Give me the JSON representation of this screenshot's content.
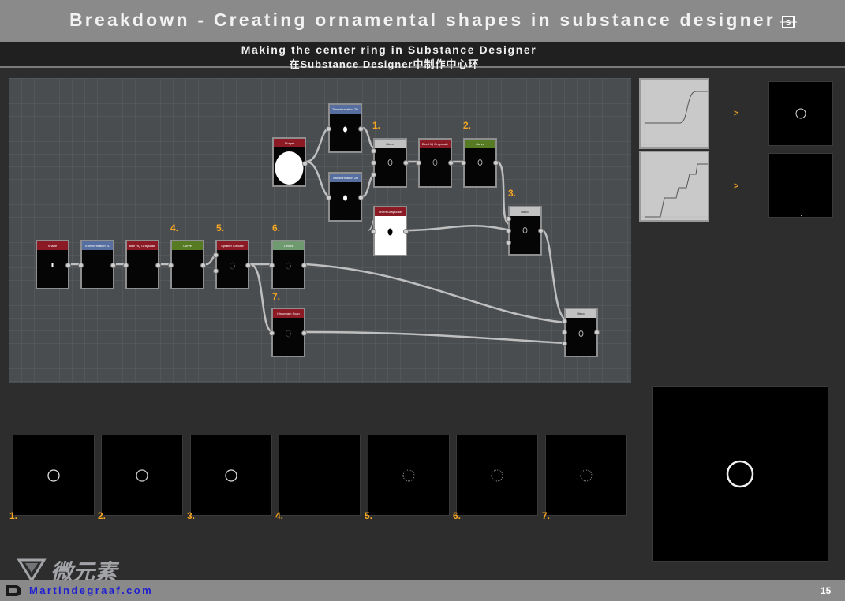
{
  "header": {
    "title": "Breakdown - Creating ornamental shapes in substance designer",
    "subtitle_en": "Making the center ring in Substance Designer",
    "subtitle_cn": "在Substance Designer中制作中心环"
  },
  "graph": {
    "nodes": [
      {
        "label": "Shape"
      },
      {
        "label": "Transformation 2D"
      },
      {
        "label": "Transformation 2D"
      },
      {
        "label": "Blend"
      },
      {
        "label": "Blur HQ Grayscale"
      },
      {
        "label": "Curve"
      },
      {
        "label": "Invert Grayscale"
      },
      {
        "label": "Blend"
      },
      {
        "label": "Shape"
      },
      {
        "label": "Transformation 2D"
      },
      {
        "label": "Blur HQ Grayscale"
      },
      {
        "label": "Curve"
      },
      {
        "label": "Splatter Circular"
      },
      {
        "label": "Levels"
      },
      {
        "label": "Histogram Scan"
      },
      {
        "label": "Blend"
      }
    ],
    "step_labels": [
      "1.",
      "2.",
      "3.",
      "4.",
      "5.",
      "6.",
      "7."
    ]
  },
  "curves": {
    "arrow": ">"
  },
  "previews": {
    "labels": [
      "1.",
      "2.",
      "3.",
      "4.",
      "5.",
      "6.",
      "7."
    ]
  },
  "footer": {
    "link": "Martindegraaf.com",
    "page": "15"
  },
  "watermark": {
    "text": "微元素"
  },
  "colors": {
    "accent": "#f5a623",
    "title_bar": "#8a8a8a",
    "node_red": "#8b1a24",
    "node_blue": "#566fa0",
    "node_green": "#567b22"
  }
}
